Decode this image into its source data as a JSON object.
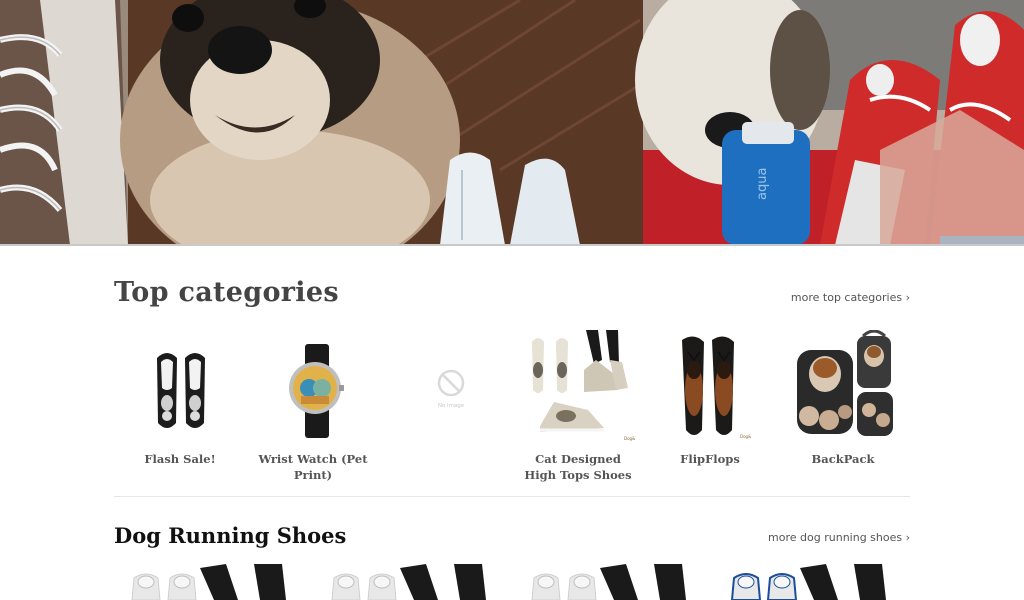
{
  "top_categories": {
    "title": "Top categories",
    "more_link": "more top categories ›",
    "items": [
      {
        "label": "Flash Sale!",
        "icon": "sneakers-image"
      },
      {
        "label": "Wrist Watch (Pet Print)",
        "icon": "watch-image"
      },
      {
        "label": "",
        "icon": "no-image-placeholder",
        "placeholder_text": "No image"
      },
      {
        "label": "Cat Designed High Tops Shoes",
        "icon": "cat-shoes-image"
      },
      {
        "label": "FlipFlops",
        "icon": "flipflops-image"
      },
      {
        "label": "BackPack",
        "icon": "backpack-image"
      }
    ]
  },
  "dog_running_shoes": {
    "title": "Dog Running Shoes",
    "more_link": "more dog running shoes ›",
    "items": [
      {
        "icon": "running-shoe-image"
      },
      {
        "icon": "running-shoe-image"
      },
      {
        "icon": "running-shoe-image"
      },
      {
        "icon": "running-shoe-image",
        "accent": "#1b4f9c"
      }
    ]
  },
  "colors": {
    "heading": "#444444",
    "link": "#555555",
    "divider": "#e6e6e6"
  }
}
